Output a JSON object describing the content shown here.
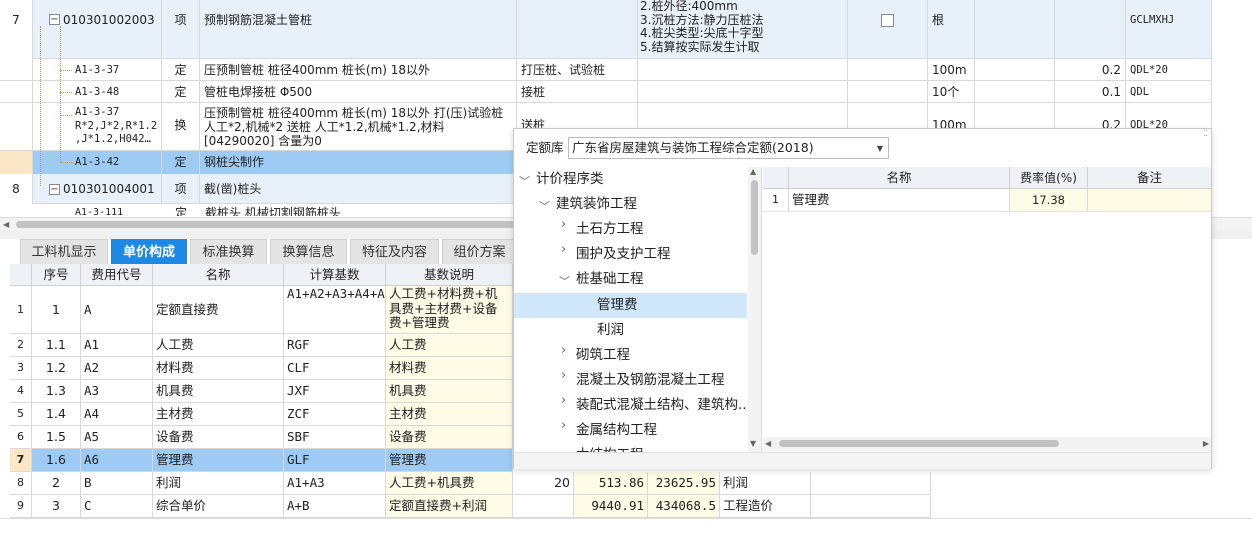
{
  "top_table": {
    "row7": {
      "num": "7",
      "code": "010301002003",
      "type": "项",
      "name": "预制钢筋混凝土管桩",
      "features": [
        "2.桩外径:400mm",
        "3.沉桩方法:静力压桩法",
        "4.桩尖类型:尖底十字型",
        "5.结算按实际发生计取"
      ],
      "unit": "根",
      "formula": "GCLMXHJ"
    },
    "sub1": {
      "code": "A1-3-37",
      "type": "定",
      "name": "压预制管桩 桩径400mm 桩长(m) 18以外",
      "desc": "打压桩、试验桩",
      "unit": "100m",
      "qty": "0.2",
      "formula": "QDL*20"
    },
    "sub2": {
      "code": "A1-3-48",
      "type": "定",
      "name": "管桩电焊接桩 Φ500",
      "desc": "接桩",
      "unit": "10个",
      "qty": "0.1",
      "formula": "QDL"
    },
    "sub3": {
      "code_lines": [
        "A1-3-37",
        "R*2,J*2,R*1.2",
        ",J*1.2,H042…"
      ],
      "type": "换",
      "name_lines": [
        "压预制管桩 桩径400mm 桩长(m) 18以外  打(压)试验桩",
        "人工*2,机械*2  送桩 人工*1.2,机械*1.2,材料",
        "[04290020] 含量为0"
      ],
      "desc": "送桩",
      "unit": "100m",
      "qty": "0.2",
      "formula": "QDL*20"
    },
    "sub4": {
      "code": "A1-3-42",
      "type": "定",
      "name": "钢桩尖制作"
    },
    "row8": {
      "num": "8",
      "code": "010301004001",
      "type": "项",
      "name": "截(凿)桩头"
    },
    "row9_partial": {
      "code": "A1-3-111",
      "type": "定",
      "name": "截桩头 机械切割钢筋桩头"
    }
  },
  "tabs": [
    {
      "label": "工料机显示"
    },
    {
      "label": "单价构成"
    },
    {
      "label": "标准换算"
    },
    {
      "label": "换算信息"
    },
    {
      "label": "特征及内容"
    },
    {
      "label": "组价方案"
    }
  ],
  "bottom_table": {
    "headers": [
      "序号",
      "费用代号",
      "名称",
      "计算基数",
      "基数说明"
    ],
    "rows": [
      {
        "rn": "1",
        "seq": "1",
        "code": "A",
        "name": "定额直接费",
        "base": "A1+A2+A3+A4+A5+A6",
        "desc": "人工费+材料费+机具费+主材费+设备费+管理费"
      },
      {
        "rn": "2",
        "seq": "1.1",
        "code": "A1",
        "name": "人工费",
        "base": "RGF",
        "desc": "人工费"
      },
      {
        "rn": "3",
        "seq": "1.2",
        "code": "A2",
        "name": "材料费",
        "base": "CLF",
        "desc": "材料费"
      },
      {
        "rn": "4",
        "seq": "1.3",
        "code": "A3",
        "name": "机具费",
        "base": "JXF",
        "desc": "机具费"
      },
      {
        "rn": "5",
        "seq": "1.4",
        "code": "A4",
        "name": "主材费",
        "base": "ZCF",
        "desc": "主材费"
      },
      {
        "rn": "6",
        "seq": "1.5",
        "code": "A5",
        "name": "设备费",
        "base": "SBF",
        "desc": "设备费"
      },
      {
        "rn": "7",
        "seq": "1.6",
        "code": "A6",
        "name": "管理费",
        "base": "GLF",
        "desc": "管理费"
      },
      {
        "rn": "8",
        "seq": "2",
        "code": "B",
        "name": "利润",
        "base": "A1+A3",
        "desc": "人工费+机具费",
        "rate": "20",
        "price": "513.86",
        "total": "23625.95",
        "type": "利润"
      },
      {
        "rn": "9",
        "seq": "3",
        "code": "C",
        "name": "综合单价",
        "base": "A+B",
        "desc": "定额直接费+利润",
        "rate": "",
        "price": "9440.91",
        "total": "434068.5",
        "type": "工程造价"
      }
    ]
  },
  "popup": {
    "lib_label": "定额库",
    "lib_value": "广东省房屋建筑与装饰工程综合定额(2018)",
    "tree": [
      {
        "label": "计价程序类"
      },
      {
        "label": "建筑装饰工程"
      },
      {
        "label": "土石方工程"
      },
      {
        "label": "围护及支护工程"
      },
      {
        "label": "桩基础工程"
      },
      {
        "label": "管理费"
      },
      {
        "label": "利润"
      },
      {
        "label": "砌筑工程"
      },
      {
        "label": "混凝土及钢筋混凝土工程"
      },
      {
        "label": "装配式混凝土结构、建筑构..."
      },
      {
        "label": "金属结构工程"
      },
      {
        "label": "木结构工程"
      }
    ],
    "grid_headers": [
      "名称",
      "费率值(%)",
      "备注"
    ],
    "grid_rows": [
      {
        "rn": "1",
        "name": "管理费",
        "rate": "17.38",
        "note": ""
      }
    ]
  }
}
